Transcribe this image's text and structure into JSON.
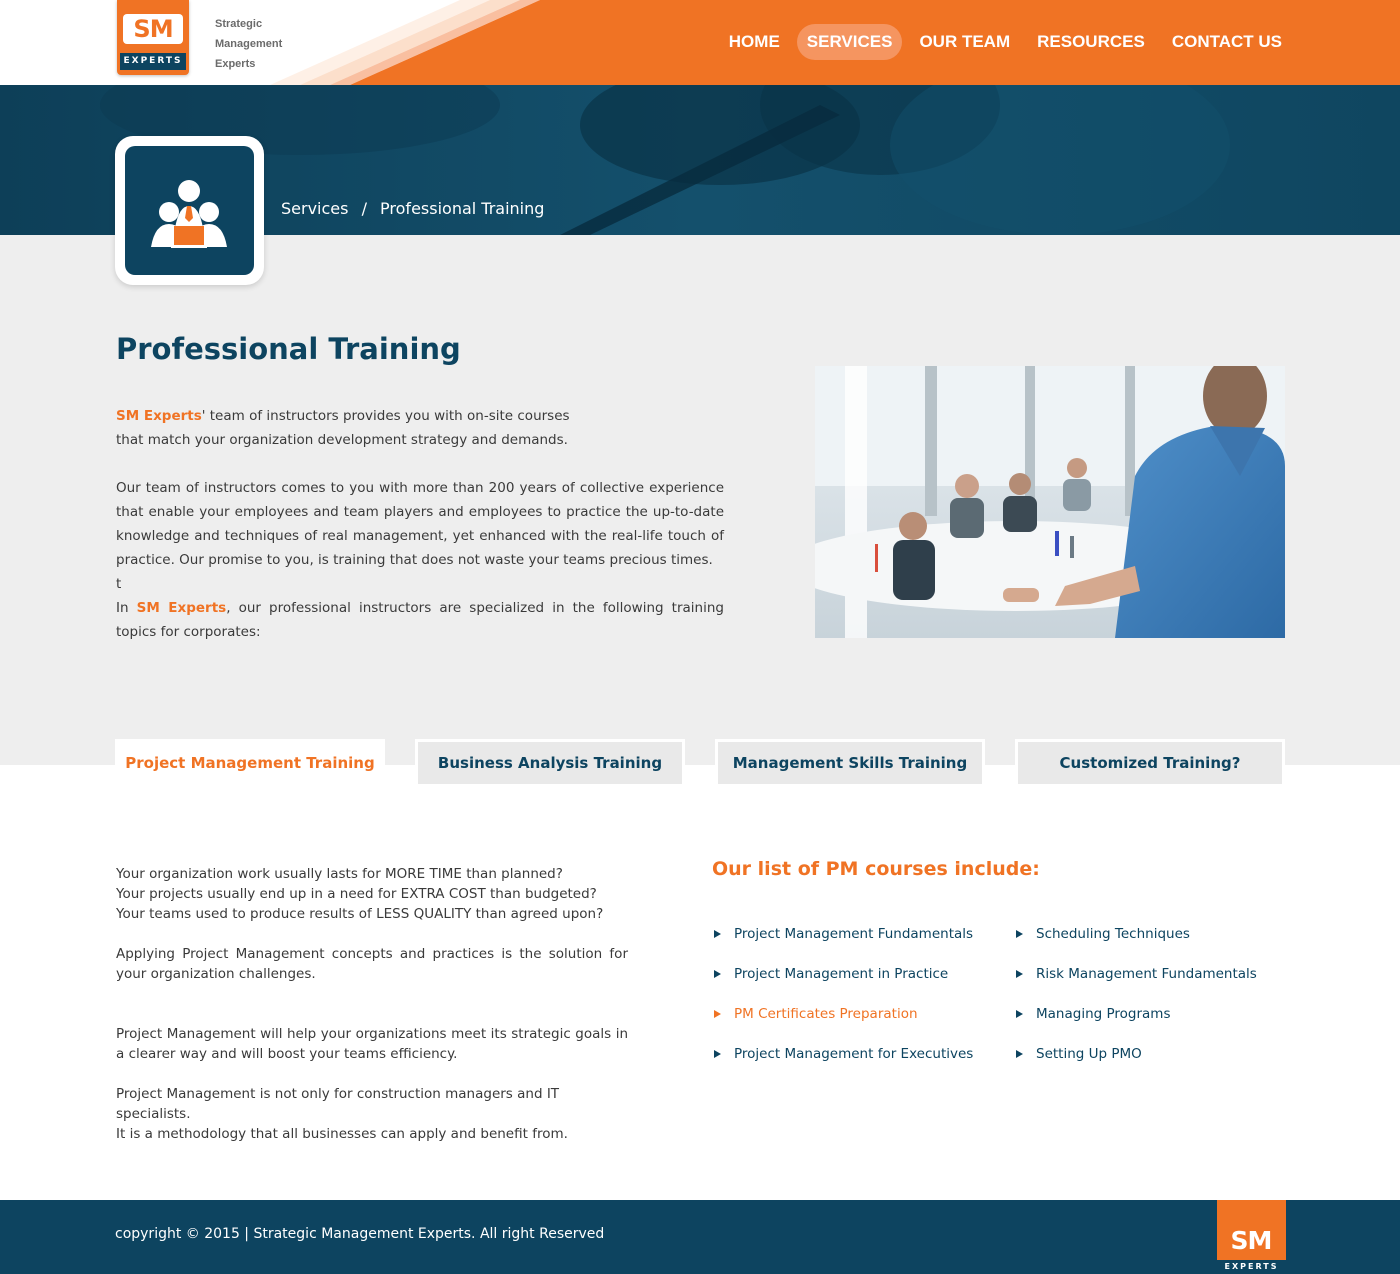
{
  "brand": {
    "logo_sm": "SM",
    "logo_experts": "EXPERTS",
    "tagline": [
      "Strategic",
      "Management",
      "Experts"
    ]
  },
  "nav": {
    "items": [
      {
        "label": "HOME",
        "active": false
      },
      {
        "label": "SERVICES",
        "active": true
      },
      {
        "label": "OUR TEAM",
        "active": false
      },
      {
        "label": "RESOURCES",
        "active": false
      },
      {
        "label": "CONTACT US",
        "active": false
      }
    ]
  },
  "breadcrumb": {
    "section": "Services",
    "separator": "/",
    "current": "Professional Training"
  },
  "page": {
    "title": "Professional Training",
    "intro_p1_brand": "SM Experts",
    "intro_p1_rest": "' team of instructors provides you with on-site courses that match your organization development strategy and demands.",
    "intro_p2": "Our team of instructors comes to you with more than 200 years of collective experience that enable your employees and team players and employees to practice the up-to-date knowledge and techniques of real management, yet enhanced with the real-life touch of practice. Our promise to you, is training that does not waste your teams precious times.",
    "intro_stray": "t",
    "intro_p3_pre": "In ",
    "intro_p3_brand": "SM Experts",
    "intro_p3_rest": ", our professional instructors are specialized in the following training topics for corporates:"
  },
  "tabs": [
    {
      "label": "Project Management Training",
      "active": true
    },
    {
      "label": "Business Analysis Training",
      "active": false
    },
    {
      "label": "Management Skills Training",
      "active": false
    },
    {
      "label": "Customized Training?",
      "active": false
    }
  ],
  "content": {
    "q1": "Your organization work usually lasts for MORE TIME than planned?",
    "q2": "Your projects usually end up in a need for EXTRA COST than budgeted?",
    "q3": "Your teams used to produce results of LESS QUALITY than agreed upon?",
    "p1": "Applying Project Management concepts and practices is the solution for your organization challenges.",
    "p2": "Project Management will help your organizations meet its strategic goals in a clearer way and will boost your teams efficiency.",
    "p3a": "Project Management is not only for construction managers and IT specialists.",
    "p3b": "It is a methodology that all businesses can apply and benefit from."
  },
  "courses": {
    "title": "Our list of PM courses include:",
    "col1": [
      {
        "label": "Project Management Fundamentals",
        "active": false
      },
      {
        "label": "Project Management in Practice",
        "active": false
      },
      {
        "label": "PM Certificates Preparation",
        "active": true
      },
      {
        "label": "Project Management for Executives",
        "active": false
      }
    ],
    "col2": [
      {
        "label": "Scheduling Techniques",
        "active": false
      },
      {
        "label": "Risk Management Fundamentals",
        "active": false
      },
      {
        "label": "Managing Programs",
        "active": false
      },
      {
        "label": "Setting Up PMO",
        "active": false
      }
    ]
  },
  "footer": {
    "copyright": "copyright © 2015  |  Strategic Management Experts. All right Reserved",
    "logo_sm": "SM",
    "logo_experts": "EXPERTS"
  },
  "colors": {
    "brand_orange": "#f07324",
    "brand_navy": "#0d4460",
    "page_grey": "#eeeeee"
  }
}
